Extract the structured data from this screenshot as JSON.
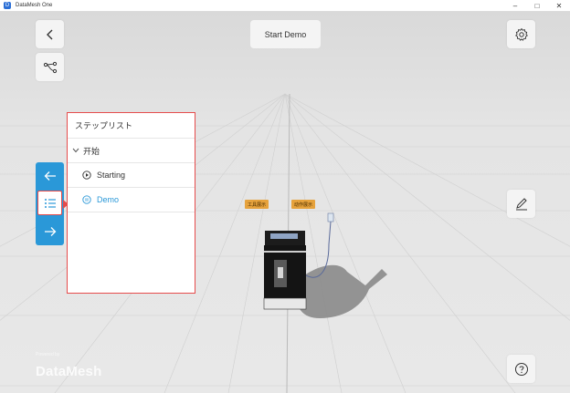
{
  "window": {
    "title": "DataMesh One",
    "app_icon": "D",
    "minimize": "–",
    "maximize": "□",
    "close": "✕"
  },
  "toolbar": {
    "start_demo": "Start Demo"
  },
  "step_panel": {
    "title": "ステップリスト",
    "group": {
      "label": "开始"
    },
    "steps": [
      {
        "label": "Starting",
        "icon": "play-circle-icon",
        "active": false
      },
      {
        "label": "Demo",
        "icon": "step-circle-icon",
        "active": true
      }
    ]
  },
  "scene": {
    "tags": [
      "工具展示",
      "动作展示"
    ]
  },
  "brand": {
    "name": "DataMesh",
    "sub": "Powered by"
  },
  "colors": {
    "accent": "#2a98d8",
    "highlight": "#e64b4b",
    "tag": "#e6a23c"
  }
}
